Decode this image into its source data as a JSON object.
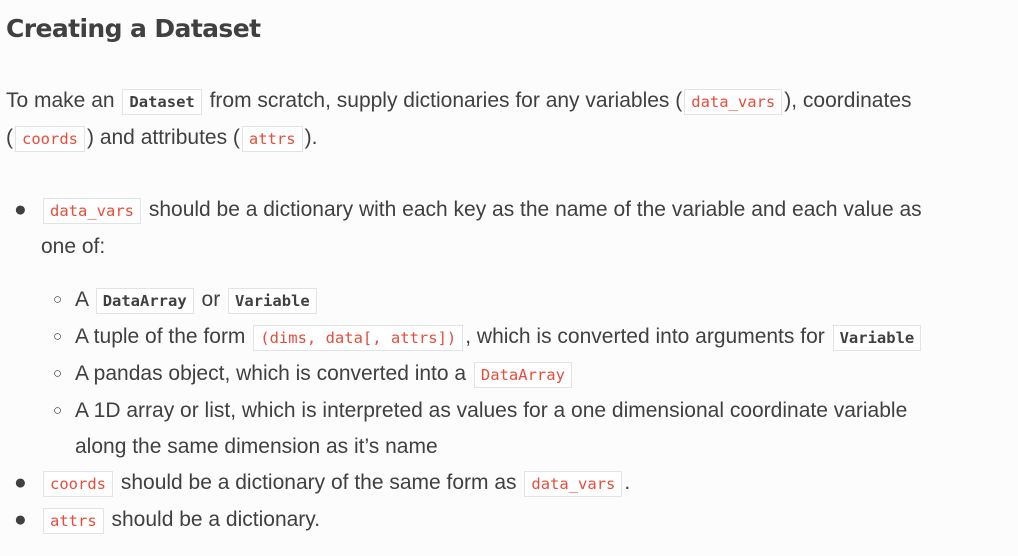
{
  "heading": "Creating a Dataset",
  "intro": {
    "t1": "To make an ",
    "c1": "Dataset",
    "t2": " from scratch, supply dictionaries for any variables (",
    "c2": "data_vars",
    "t3": "), coordinates",
    "t4": "(",
    "c3": "coords",
    "t5": ") and attributes (",
    "c4": "attrs",
    "t6": ")."
  },
  "items": [
    {
      "code": "data_vars",
      "text_line1": " should be a dictionary with each key as the name of the variable and each value as",
      "text_line2": "one of:",
      "sub": [
        {
          "t1": "A ",
          "c1": "DataArray",
          "t2": " or ",
          "c2": "Variable"
        },
        {
          "t1": "A tuple of the form ",
          "c1": "(dims, data[, attrs])",
          "t2": ", which is converted into arguments for ",
          "c2": "Variable"
        },
        {
          "t1": "A pandas object, which is converted into a ",
          "c1": "DataArray"
        },
        {
          "line1": "A 1D array or list, which is interpreted as values for a one dimensional coordinate variable",
          "line2": "along the same dimension as it’s name"
        }
      ]
    },
    {
      "code": "coords",
      "t1": " should be a dictionary of the same form as ",
      "c2": "data_vars",
      "t2": "."
    },
    {
      "code": "attrs",
      "t1": " should be a dictionary."
    }
  ]
}
